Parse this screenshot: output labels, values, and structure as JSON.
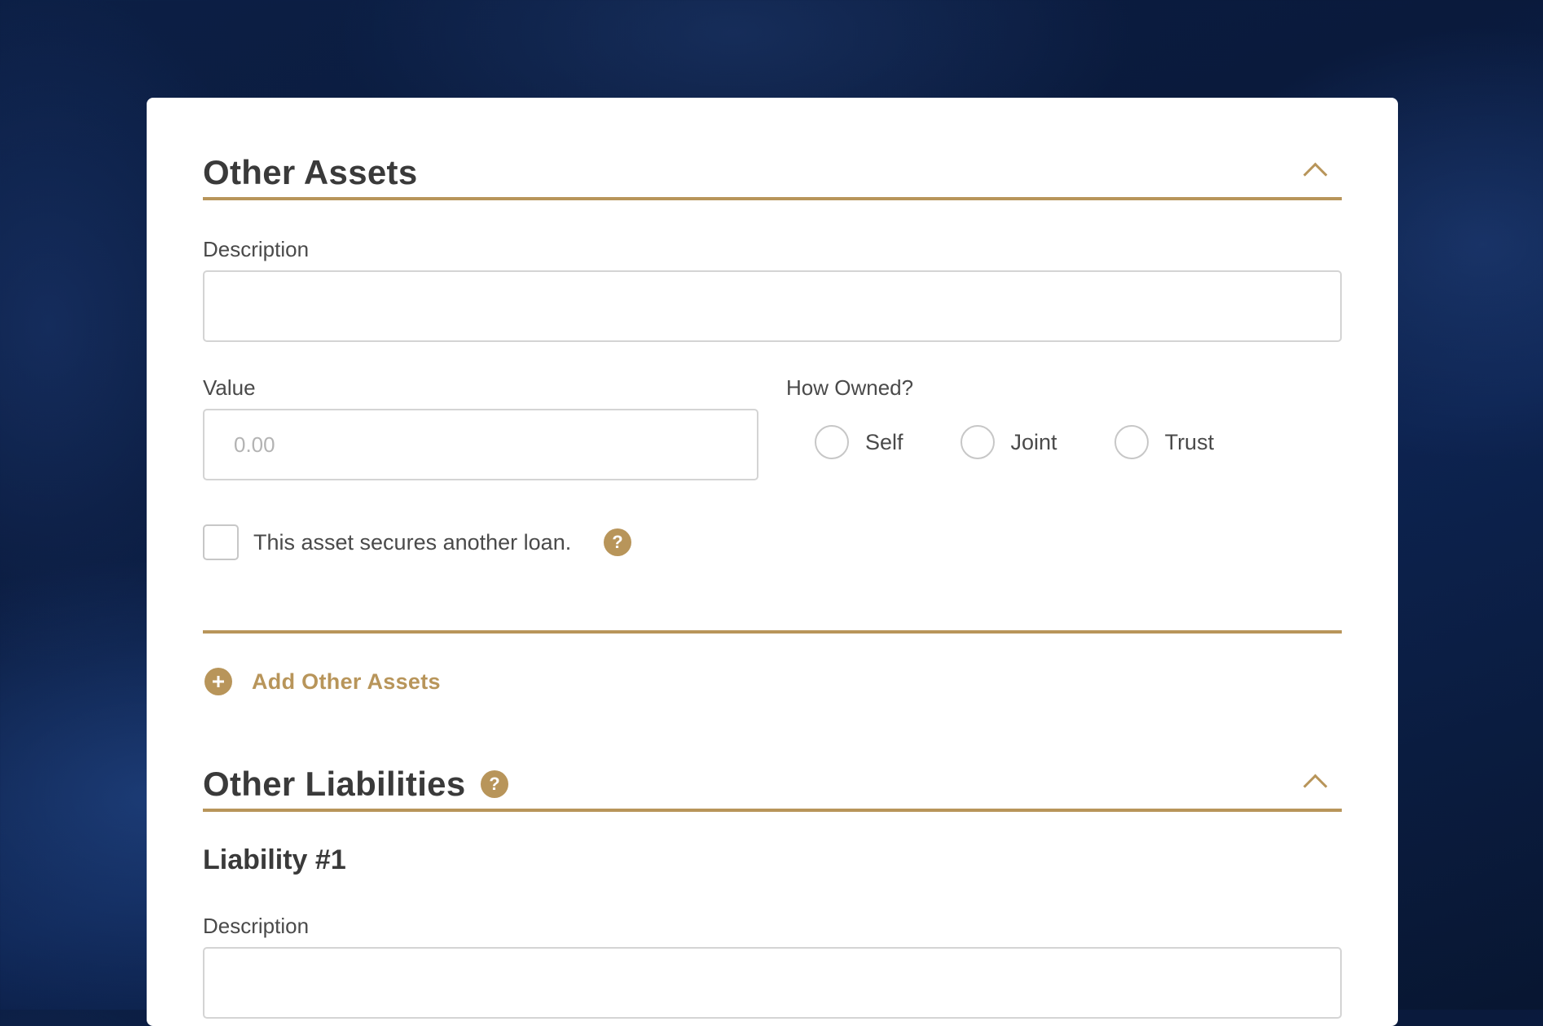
{
  "other_assets": {
    "title": "Other Assets",
    "description_label": "Description",
    "description_value": "",
    "value_label": "Value",
    "value_placeholder": "0.00",
    "how_owned_label": "How Owned?",
    "how_owned_options": [
      "Self",
      "Joint",
      "Trust"
    ],
    "secures_loan_label": "This asset secures another loan.",
    "help_icon": "?",
    "add_label": "Add Other Assets"
  },
  "other_liabilities": {
    "title": "Other Liabilities",
    "help_icon": "?",
    "item_title": "Liability #1",
    "description_label": "Description",
    "description_value": ""
  },
  "colors": {
    "accent": "#b8955a",
    "background": "#0a1a3c",
    "card": "#ffffff"
  },
  "icons": {
    "collapse": "chevron-up-icon",
    "help": "question-mark-icon",
    "add": "plus-circle-icon"
  }
}
